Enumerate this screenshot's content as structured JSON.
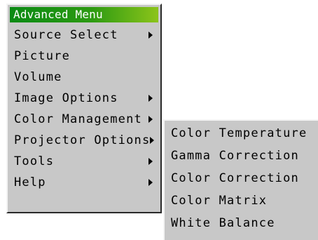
{
  "menu": {
    "title": "Advanced Menu",
    "items": [
      {
        "label": "Source Select",
        "has_submenu": true
      },
      {
        "label": "Picture",
        "has_submenu": false
      },
      {
        "label": "Volume",
        "has_submenu": false
      },
      {
        "label": "Image Options",
        "has_submenu": true
      },
      {
        "label": "Color Management",
        "has_submenu": true
      },
      {
        "label": "Projector Options",
        "has_submenu": true
      },
      {
        "label": "Tools",
        "has_submenu": true
      },
      {
        "label": "Help",
        "has_submenu": true
      }
    ]
  },
  "submenu": {
    "parent": "Color Management",
    "items": [
      {
        "label": "Color Temperature"
      },
      {
        "label": "Gamma Correction"
      },
      {
        "label": "Color Correction"
      },
      {
        "label": "Color Matrix"
      },
      {
        "label": "White Balance"
      }
    ]
  },
  "colors": {
    "menu_background": "#c8c8c8",
    "title_gradient_start": "#0a8a14",
    "title_gradient_end": "#8cc41a",
    "title_text": "#ffffff",
    "text": "#000000"
  },
  "icons": {
    "submenu_indicator": "triangle-right-icon"
  }
}
